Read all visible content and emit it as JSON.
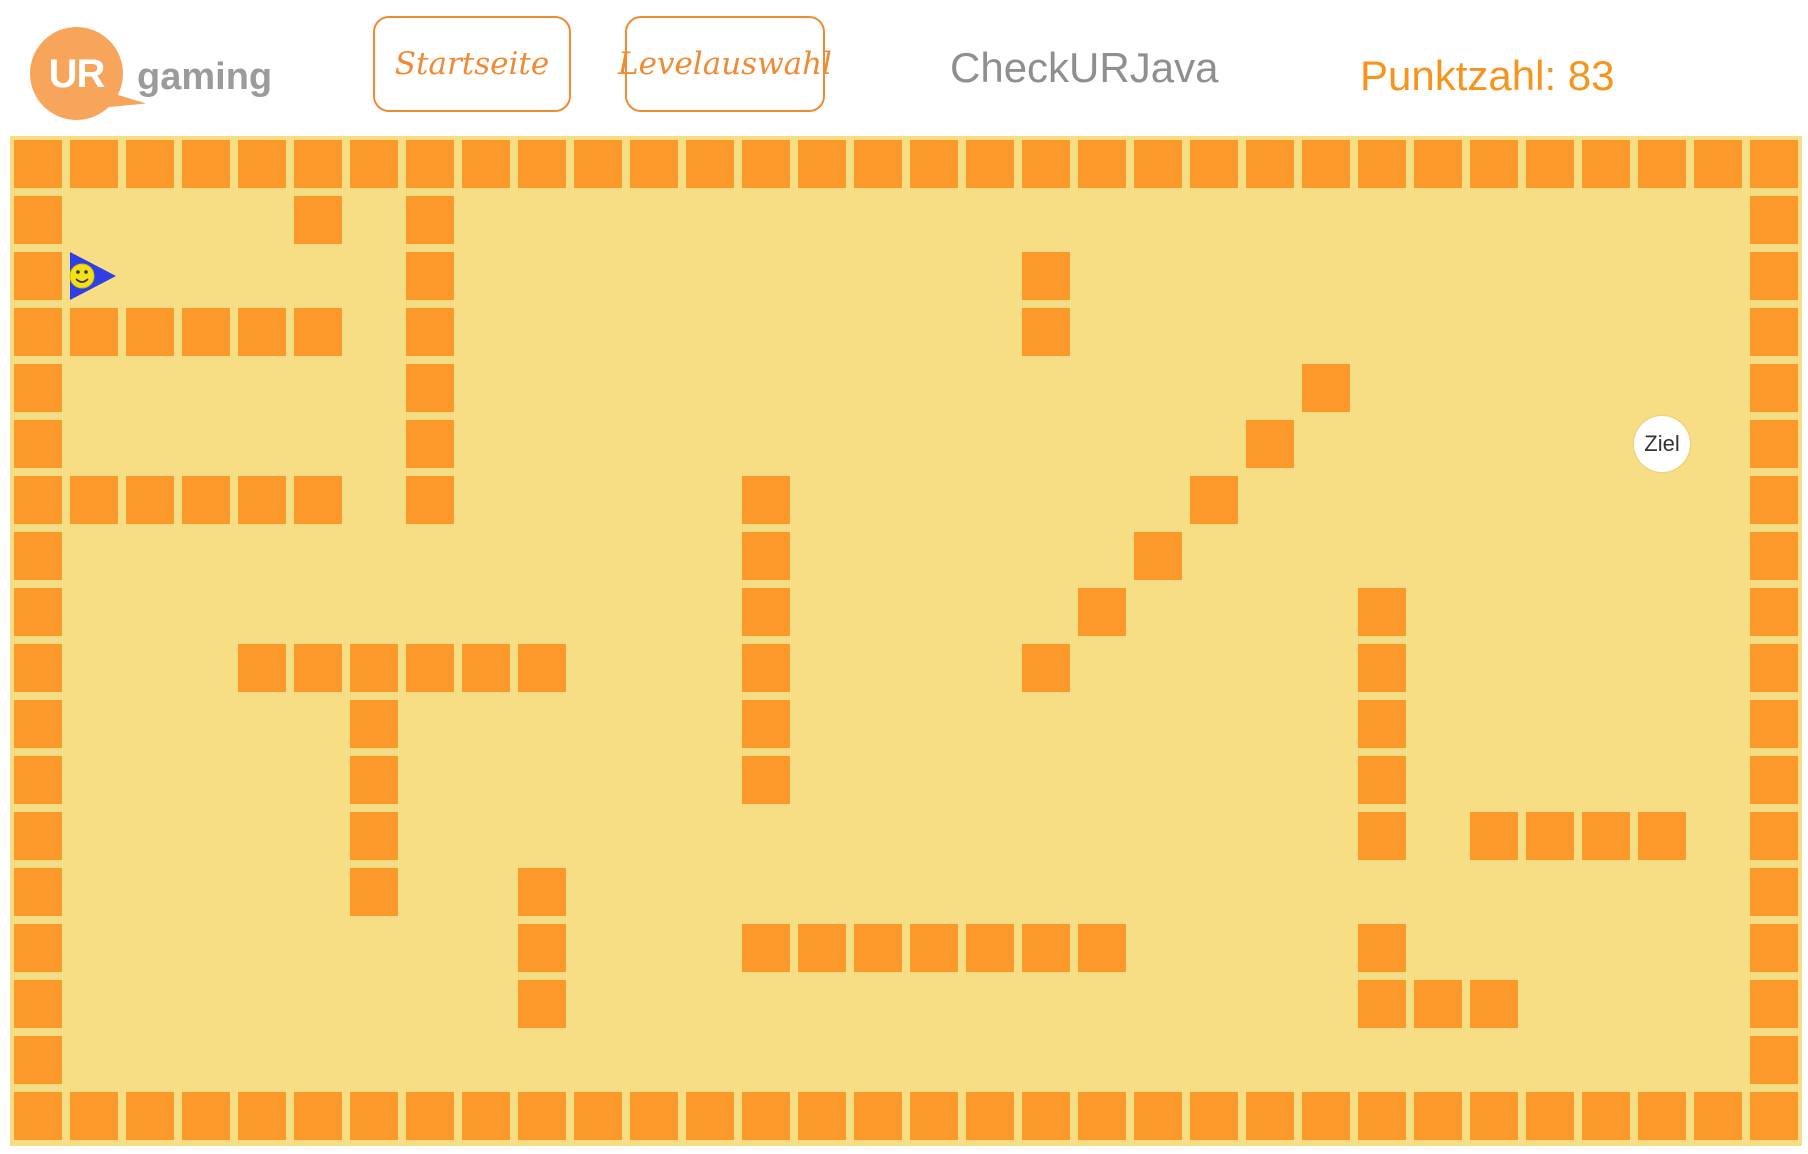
{
  "header": {
    "logo_mark": "UR",
    "logo_text": "gaming",
    "nav": {
      "start_label": "Startseite",
      "level_label": "Levelauswahl"
    },
    "app_title": "CheckURJava",
    "score_text": "Punktzahl: 83"
  },
  "colors": {
    "accent": "#f7941d",
    "wall": "#fb9a2a",
    "floor": "#f7dd83",
    "player_arrow": "#2f3fe8",
    "player_face": "#f2e01a"
  },
  "board": {
    "columns": 32,
    "rows": 18,
    "walls": [
      [
        1,
        1
      ],
      [
        6,
        1
      ],
      [
        8,
        1
      ],
      [
        1,
        2
      ],
      [
        8,
        2
      ],
      [
        19,
        2
      ],
      [
        1,
        3
      ],
      [
        2,
        3
      ],
      [
        3,
        3
      ],
      [
        4,
        3
      ],
      [
        5,
        3
      ],
      [
        6,
        3
      ],
      [
        8,
        3
      ],
      [
        19,
        3
      ],
      [
        1,
        4
      ],
      [
        8,
        4
      ],
      [
        24,
        4
      ],
      [
        1,
        5
      ],
      [
        8,
        5
      ],
      [
        23,
        5
      ],
      [
        1,
        6
      ],
      [
        2,
        6
      ],
      [
        3,
        6
      ],
      [
        4,
        6
      ],
      [
        5,
        6
      ],
      [
        6,
        6
      ],
      [
        8,
        6
      ],
      [
        14,
        6
      ],
      [
        22,
        6
      ],
      [
        1,
        7
      ],
      [
        14,
        7
      ],
      [
        21,
        7
      ],
      [
        1,
        8
      ],
      [
        14,
        8
      ],
      [
        20,
        8
      ],
      [
        25,
        8
      ],
      [
        1,
        9
      ],
      [
        5,
        9
      ],
      [
        6,
        9
      ],
      [
        7,
        9
      ],
      [
        8,
        9
      ],
      [
        9,
        9
      ],
      [
        10,
        9
      ],
      [
        14,
        9
      ],
      [
        19,
        9
      ],
      [
        25,
        9
      ],
      [
        1,
        10
      ],
      [
        7,
        10
      ],
      [
        14,
        10
      ],
      [
        25,
        10
      ],
      [
        1,
        11
      ],
      [
        7,
        11
      ],
      [
        14,
        11
      ],
      [
        25,
        11
      ],
      [
        1,
        12
      ],
      [
        7,
        12
      ],
      [
        25,
        12
      ],
      [
        27,
        12
      ],
      [
        28,
        12
      ],
      [
        29,
        12
      ],
      [
        30,
        12
      ],
      [
        1,
        13
      ],
      [
        7,
        13
      ],
      [
        10,
        13
      ],
      [
        1,
        14
      ],
      [
        10,
        14
      ],
      [
        14,
        14
      ],
      [
        15,
        14
      ],
      [
        16,
        14
      ],
      [
        17,
        14
      ],
      [
        18,
        14
      ],
      [
        19,
        14
      ],
      [
        20,
        14
      ],
      [
        25,
        14
      ],
      [
        1,
        15
      ],
      [
        10,
        15
      ],
      [
        25,
        15
      ],
      [
        26,
        15
      ],
      [
        27,
        15
      ],
      [
        1,
        16
      ]
    ],
    "player": {
      "col": 1,
      "row": 2,
      "direction": "right",
      "icon": "smiley-arrow-icon"
    },
    "goal": {
      "col": 29,
      "row": 5,
      "label": "Ziel"
    }
  }
}
